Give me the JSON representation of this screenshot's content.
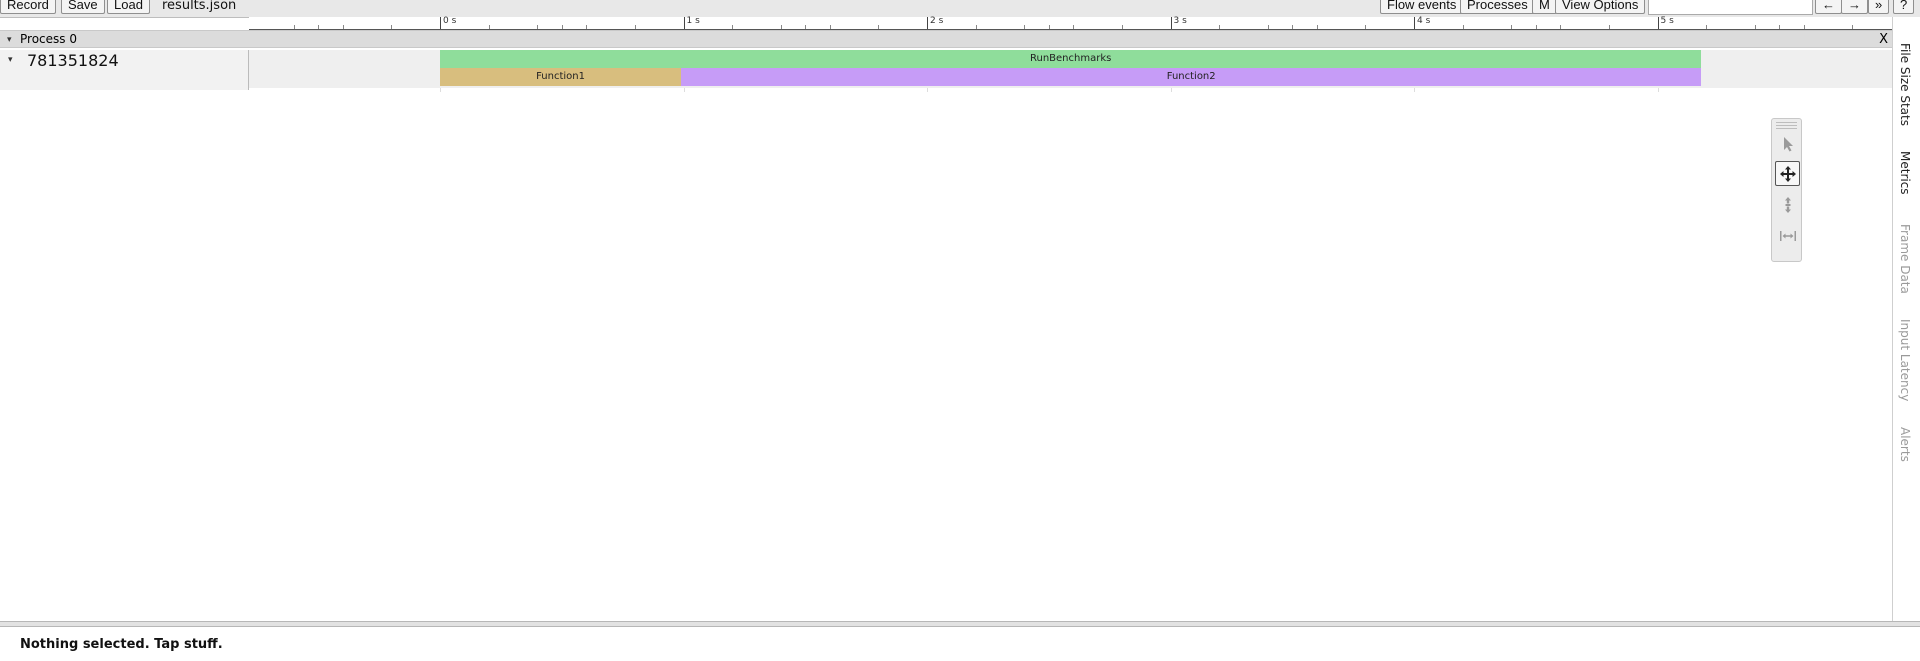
{
  "toolbar": {
    "record_label": "Record",
    "save_label": "Save",
    "load_label": "Load",
    "filename": "results.json",
    "flow_events_label": "Flow events",
    "processes_label": "Processes",
    "m_label": "M",
    "view_options_label": "View Options",
    "nav_prev_label": "←",
    "nav_next_label": "→",
    "more_label": "»",
    "help_label": "?"
  },
  "ruler": {
    "labels": [
      "0 s",
      "1 s",
      "2 s",
      "3 s",
      "4 s",
      "5 s"
    ]
  },
  "process": {
    "title": "Process 0",
    "close_label": "X",
    "thread": {
      "id": "781351824",
      "slices": [
        {
          "name": "RunBenchmarks",
          "start_s": 0.0,
          "end_s": 5.18,
          "depth": 0,
          "color": "#8fdd9b"
        },
        {
          "name": "Function1",
          "start_s": 0.0,
          "end_s": 0.99,
          "depth": 1,
          "color": "#d8be7e"
        },
        {
          "name": "Function2",
          "start_s": 0.99,
          "end_s": 5.18,
          "depth": 1,
          "color": "#c69cf7"
        }
      ]
    }
  },
  "mouse_modes": [
    {
      "icon": "pointer-icon",
      "active": false
    },
    {
      "icon": "pan-icon",
      "active": true
    },
    {
      "icon": "zoom-icon",
      "active": false
    },
    {
      "icon": "timing-icon",
      "active": false
    }
  ],
  "side_panel": {
    "tabs": [
      {
        "label": "File Size Stats",
        "active": true
      },
      {
        "label": "Metrics",
        "active": true
      },
      {
        "label": "Frame Data",
        "active": false
      },
      {
        "label": "Input Latency",
        "active": false
      },
      {
        "label": "Alerts",
        "active": false
      }
    ]
  },
  "status": {
    "text": "Nothing selected. Tap stuff."
  }
}
